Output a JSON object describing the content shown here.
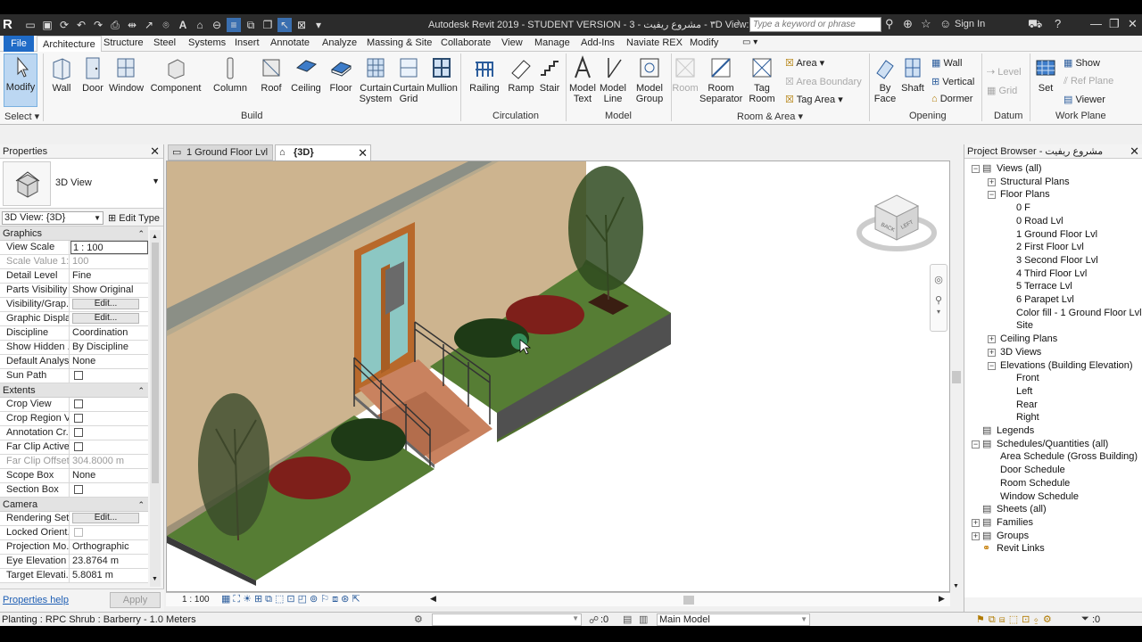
{
  "title": {
    "text": "Autodesk Revit 2019 - STUDENT VERSION - ٣ - مشروع ريفيت - 3D View: {3D}",
    "search_placeholder": "Type a keyword or phrase",
    "signin": "Sign In"
  },
  "tabs": [
    "File",
    "Architecture",
    "Structure",
    "Steel",
    "Systems",
    "Insert",
    "Annotate",
    "Analyze",
    "Massing & Site",
    "Collaborate",
    "View",
    "Manage",
    "Add-Ins",
    "Naviate REX",
    "Modify"
  ],
  "ribbon": {
    "select": {
      "modify": "Modify",
      "panel": "Select"
    },
    "build": {
      "panel": "Build",
      "wall": "Wall",
      "door": "Door",
      "window": "Window",
      "component": "Component",
      "column": "Column",
      "roof": "Roof",
      "ceiling": "Ceiling",
      "floor": "Floor",
      "curtain_system_1": "Curtain",
      "curtain_system_2": "System",
      "curtain_grid_1": "Curtain",
      "curtain_grid_2": "Grid",
      "mullion": "Mullion"
    },
    "circulation": {
      "panel": "Circulation",
      "railing": "Railing",
      "ramp": "Ramp",
      "stair": "Stair"
    },
    "model": {
      "panel": "Model",
      "model_text_1": "Model",
      "model_text_2": "Text",
      "model_line_1": "Model",
      "model_line_2": "Line",
      "model_group_1": "Model",
      "model_group_2": "Group"
    },
    "room_area": {
      "panel": "Room & Area",
      "room": "Room",
      "room_sep_1": "Room",
      "room_sep_2": "Separator",
      "tag_room_1": "Tag",
      "tag_room_2": "Room",
      "area": "Area",
      "area_boundary": "Area Boundary",
      "tag_area": "Tag  Area"
    },
    "opening": {
      "panel": "Opening",
      "by_face_1": "By",
      "by_face_2": "Face",
      "shaft": "Shaft",
      "wall": "Wall",
      "vertical": "Vertical",
      "dormer": "Dormer"
    },
    "datum": {
      "panel": "Datum",
      "level": "Level",
      "grid": "Grid"
    },
    "work_plane": {
      "panel": "Work Plane",
      "set": "Set",
      "show": "Show",
      "ref_plane": "Ref  Plane",
      "viewer": "Viewer"
    }
  },
  "properties": {
    "header": "Properties",
    "type_name": "3D View",
    "instance_selector": "3D View: {3D}",
    "edit_type": "Edit Type",
    "groups": [
      {
        "name": "Graphics",
        "rows": [
          {
            "k": "View Scale",
            "v": "1 : 100",
            "kind": "input"
          },
          {
            "k": "Scale Value    1:",
            "v": "100",
            "kind": "dis"
          },
          {
            "k": "Detail Level",
            "v": "Fine"
          },
          {
            "k": "Parts Visibility",
            "v": "Show Original"
          },
          {
            "k": "Visibility/Grap...",
            "v": "Edit...",
            "kind": "btn"
          },
          {
            "k": "Graphic Displa...",
            "v": "Edit...",
            "kind": "btn"
          },
          {
            "k": "Discipline",
            "v": "Coordination"
          },
          {
            "k": "Show Hidden ...",
            "v": "By Discipline"
          },
          {
            "k": "Default Analys...",
            "v": "None"
          },
          {
            "k": "Sun Path",
            "v": "",
            "kind": "chk"
          }
        ]
      },
      {
        "name": "Extents",
        "rows": [
          {
            "k": "Crop View",
            "v": "",
            "kind": "chk"
          },
          {
            "k": "Crop Region V...",
            "v": "",
            "kind": "chk"
          },
          {
            "k": "Annotation Cr...",
            "v": "",
            "kind": "chk"
          },
          {
            "k": "Far Clip Active",
            "v": "",
            "kind": "chk"
          },
          {
            "k": "Far Clip Offset",
            "v": "304.8000 m",
            "kind": "dis"
          },
          {
            "k": "Scope Box",
            "v": "None"
          },
          {
            "k": "Section Box",
            "v": "",
            "kind": "chk"
          }
        ]
      },
      {
        "name": "Camera",
        "rows": [
          {
            "k": "Rendering Set...",
            "v": "Edit...",
            "kind": "btn"
          },
          {
            "k": "Locked Orient...",
            "v": "",
            "kind": "chkdis"
          },
          {
            "k": "Projection Mo...",
            "v": "Orthographic"
          },
          {
            "k": "Eye Elevation",
            "v": "23.8764 m"
          },
          {
            "k": "Target Elevati...",
            "v": "5.8081 m"
          }
        ]
      }
    ],
    "help": "Properties help",
    "apply": "Apply"
  },
  "view_tabs": [
    {
      "label": "1 Ground Floor Lvl"
    },
    {
      "label": "{3D}"
    }
  ],
  "view_controls": {
    "scale": "1 : 100"
  },
  "project_browser": {
    "header": "Project Browser - مشروع ريفيت",
    "items": [
      {
        "label": "Views (all)",
        "level": 0,
        "toggle": "-"
      },
      {
        "label": "Structural Plans",
        "level": 1,
        "toggle": "+"
      },
      {
        "label": "Floor Plans",
        "level": 1,
        "toggle": "-"
      },
      {
        "label": "0 F",
        "level": 2
      },
      {
        "label": "0 Road Lvl",
        "level": 2
      },
      {
        "label": "1 Ground Floor Lvl",
        "level": 2
      },
      {
        "label": "2 First Floor Lvl",
        "level": 2
      },
      {
        "label": "3 Second Floor Lvl",
        "level": 2
      },
      {
        "label": "4 Third Floor Lvl",
        "level": 2
      },
      {
        "label": "5 Terrace Lvl",
        "level": 2
      },
      {
        "label": "6 Parapet Lvl",
        "level": 2
      },
      {
        "label": "Color fill - 1 Ground Floor Lvl",
        "level": 2
      },
      {
        "label": "Site",
        "level": 2
      },
      {
        "label": "Ceiling Plans",
        "level": 1,
        "toggle": "+"
      },
      {
        "label": "3D Views",
        "level": 1,
        "toggle": "+"
      },
      {
        "label": "Elevations (Building Elevation)",
        "level": 1,
        "toggle": "-"
      },
      {
        "label": "Front",
        "level": 2
      },
      {
        "label": "Left",
        "level": 2
      },
      {
        "label": "Rear",
        "level": 2
      },
      {
        "label": "Right",
        "level": 2
      },
      {
        "label": "Legends",
        "level": 0
      },
      {
        "label": "Schedules/Quantities (all)",
        "level": 0,
        "toggle": "-"
      },
      {
        "label": "Area Schedule (Gross Building)",
        "level": 1
      },
      {
        "label": "Door Schedule",
        "level": 1
      },
      {
        "label": "Room Schedule",
        "level": 1
      },
      {
        "label": "Window Schedule",
        "level": 1
      },
      {
        "label": "Sheets (all)",
        "level": 0
      },
      {
        "label": "Families",
        "level": 0,
        "toggle": "+"
      },
      {
        "label": "Groups",
        "level": 0,
        "toggle": "+"
      },
      {
        "label": "Revit Links",
        "level": 0
      }
    ]
  },
  "viewcube": {
    "back": "BACK",
    "left": "LEFT"
  },
  "status": {
    "message": "Planting : RPC Shrub : Barberry - 1.0 Meters",
    "workset_count": ":0",
    "model": "Main Model",
    "filter_count": ":0"
  },
  "colors": {
    "accent": "#1f6bc7",
    "selected_button": "#bcd7f2",
    "wall": "#cdb48f",
    "grass": "#567d34"
  }
}
